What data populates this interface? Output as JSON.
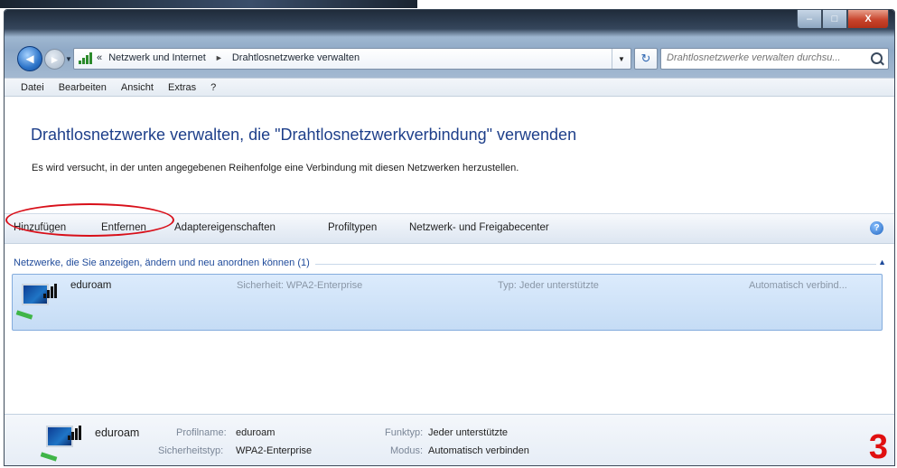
{
  "window": {
    "caption": {
      "minimize": "–",
      "maximize": "□",
      "close": "X"
    }
  },
  "nav": {
    "back_glyph": "◄",
    "forward_glyph": "►",
    "recent_glyph": "▼",
    "address": {
      "overflow": "«",
      "crumb1": "Netzwerk und Internet",
      "separator": "►",
      "crumb2": "Drahtlosnetzwerke verwalten",
      "dropdown": "▼"
    },
    "refresh_glyph": "↻",
    "search_placeholder": "Drahtlosnetzwerke verwalten durchsu..."
  },
  "menu": [
    "Datei",
    "Bearbeiten",
    "Ansicht",
    "Extras",
    "?"
  ],
  "content": {
    "title": "Drahtlosnetzwerke verwalten, die \"Drahtlosnetzwerkverbindung\" verwenden",
    "description": "Es wird versucht, in der unten angegebenen Reihenfolge eine Verbindung mit diesen Netzwerken herzustellen."
  },
  "commands": {
    "add": "Hinzufügen",
    "remove": "Entfernen",
    "adapter": "Adaptereigenschaften",
    "profiles": "Profiltypen",
    "center": "Netzwerk- und Freigabecenter",
    "help": "?"
  },
  "group": {
    "label": "Netzwerke, die Sie anzeigen, ändern und neu anordnen können (1)",
    "collapse_glyph": "▲"
  },
  "network": {
    "name": "eduroam",
    "security": "Sicherheit: WPA2-Enterprise",
    "type": "Typ: Jeder unterstützte",
    "mode": "Automatisch verbind..."
  },
  "details": {
    "name": "eduroam",
    "profile_label": "Profilname:",
    "profile_value": "eduroam",
    "security_label": "Sicherheitstyp:",
    "security_value": "WPA2-Enterprise",
    "radio_label": "Funktyp:",
    "radio_value": "Jeder unterstützte",
    "mode_label": "Modus:",
    "mode_value": "Automatisch verbinden"
  },
  "annotation": {
    "number": "3",
    "color": "#e01010"
  }
}
